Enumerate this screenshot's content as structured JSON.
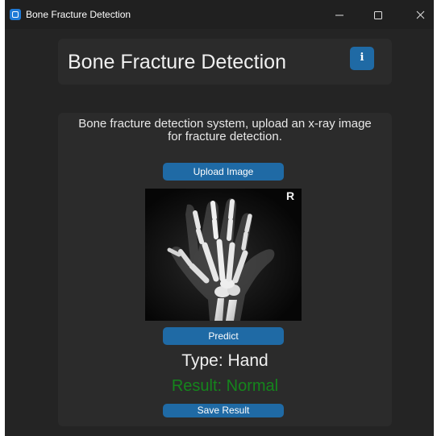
{
  "window": {
    "title": "Bone Fracture Detection",
    "controls": {
      "minimize_icon": "minimize-icon",
      "maximize_icon": "maximize-icon",
      "close_icon": "close-icon"
    }
  },
  "header": {
    "title": "Bone Fracture Detection",
    "info_button": {
      "glyph": "i",
      "icon": "info-icon"
    }
  },
  "main": {
    "description": "Bone fracture detection system, upload an x-ray image for fracture detection.",
    "upload_label": "Upload Image",
    "predict_label": "Predict",
    "xray_marker": "R",
    "type_text": "Type: Hand",
    "result_text": "Result: Normal",
    "save_label": "Save Result"
  },
  "colors": {
    "window_bg": "#242424",
    "panel_bg": "#2b2b2b",
    "accent": "#1f6aa5",
    "result_normal": "#15851c"
  }
}
